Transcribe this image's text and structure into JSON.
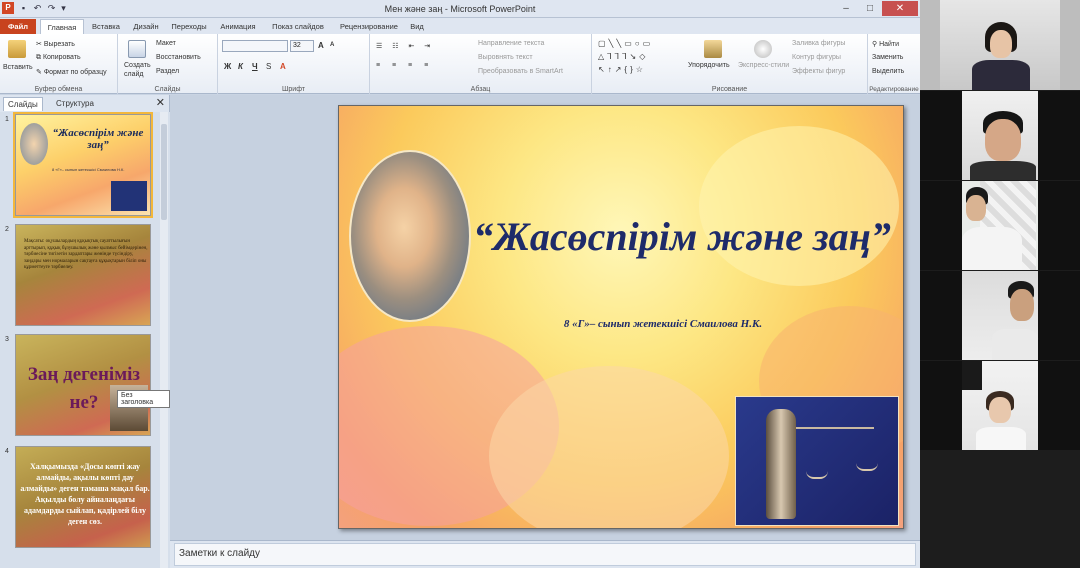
{
  "window": {
    "title": "Мен және заң  -  Microsoft PowerPoint",
    "app_letter": "P",
    "controls": {
      "minimize": "–",
      "maximize": "□",
      "close": "✕"
    }
  },
  "tabs": [
    "Файл",
    "Главная",
    "Вставка",
    "Дизайн",
    "Переходы",
    "Анимация",
    "Показ слайдов",
    "Рецензирование",
    "Вид"
  ],
  "ribbon": {
    "clipboard": {
      "paste": "Вставить",
      "cut": "Вырезать",
      "copy": "Копировать",
      "format": "Формат по образцу",
      "label": "Буфер обмена"
    },
    "slides": {
      "new": "Создать",
      "new2": "слайд",
      "layout": "Макет",
      "reset": "Восстановить",
      "section": "Раздел",
      "label": "Слайды"
    },
    "font": {
      "size": "32",
      "label": "Шрифт"
    },
    "paragraph": {
      "direction": "Направление текста",
      "align": "Выровнять текст",
      "smartart": "Преобразовать в SmartArt",
      "label": "Абзац"
    },
    "drawing": {
      "arrange": "Упорядочить",
      "express": "Экспресс-стили",
      "fill": "Заливка фигуры",
      "outline": "Контур фигуры",
      "effects": "Эффекты фигур",
      "label": "Рисование"
    },
    "editing": {
      "find": "Найти",
      "replace": "Заменить",
      "select": "Выделить",
      "label": "Редактирование"
    }
  },
  "left_pane": {
    "tabs": [
      "Слайды",
      "Структура"
    ],
    "close": "✕",
    "tooltip": "Без заголовка",
    "thumbnails": [
      {
        "num": "1",
        "title": "“Жасөспірім және заң”",
        "sub": "8 «Г»– сынып жетекшісі Смаилова Н.К."
      },
      {
        "num": "2",
        "text": "Мақсаты: оқушылардың құқықтық сауаттылығын арттырып, құқық бұзушылық және қылмыс бейімдерінен, тәрбиесіне тигізетін зардаптары жөнінде түсіндіру, заңдары мен нормаларын сақтауға құқықтарын біліп оны құрметтеуге тәрбиелеу."
      },
      {
        "num": "3",
        "title": "Заң дегеніміз не?"
      },
      {
        "num": "4",
        "text": "Халқымызда «Досы көпті жау алмайды, ақылы көпті дау алмайды» деген тамаша мақал бар. Ақылды болу айналаңдағы адамдарды сыйлап, қадірлей білу деген сөз."
      }
    ]
  },
  "slide": {
    "title": "“Жасөспірім  және заң”",
    "subtitle": "8 «Г»– сынып жетекшісі  Смаилова Н.К."
  },
  "notes": {
    "placeholder": "Заметки к слайду"
  },
  "colors": {
    "accent": "#c8431e",
    "title_blue": "#1e2b6a"
  }
}
